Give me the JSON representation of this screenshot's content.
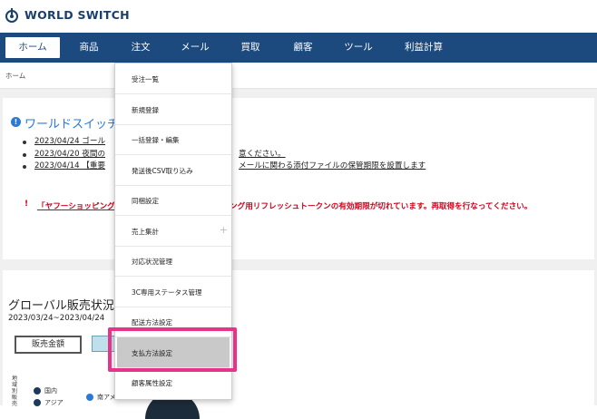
{
  "header": {
    "logo_text": "WORLD SWITCH",
    "logo_icon": "power-plug-icon"
  },
  "nav": {
    "items": [
      {
        "label": "ホーム",
        "active": true
      },
      {
        "label": "商品"
      },
      {
        "label": "注文"
      },
      {
        "label": "メール"
      },
      {
        "label": "買取"
      },
      {
        "label": "顧客"
      },
      {
        "label": "ツール"
      },
      {
        "label": "利益計算"
      }
    ]
  },
  "breadcrumb": "ホーム",
  "notice": {
    "title": "ワールドスイッチ",
    "items": [
      "2023/04/24 ゴール",
      "2023/04/20 夜間の",
      "2023/04/14 【重要"
    ],
    "item2_tail": "意ください。",
    "item3_tail": "メールに関わる添付ファイルの保管期限を設置します",
    "warning_head": "「ヤフーショッピング",
    "warning_tail": "ング用リフレッシュトークンの有効期限が切れています。再取得を行なってください。"
  },
  "global": {
    "title": "グローバル販売状況",
    "date_range": "2023/03/24~2023/04/24",
    "tab_label": "販売金額",
    "vertical_label": "地域別販売",
    "legend": [
      "国内",
      "アジア",
      "南アメリカ"
    ]
  },
  "dropdown": {
    "items": [
      "受注一覧",
      "新規登録",
      "一括登録・編集",
      "発送後CSV取り込み",
      "同梱設定",
      "売上集計",
      "対応状況管理",
      "3C専用ステータス管理",
      "配送方法設定",
      "支払方法設定",
      "顧客属性設定"
    ],
    "selected": "支払方法設定"
  },
  "colors": {
    "nav_bg": "#1c4a7e",
    "accent": "#2a7ad4",
    "warning": "#d0021b",
    "highlight": "#e8338a"
  }
}
